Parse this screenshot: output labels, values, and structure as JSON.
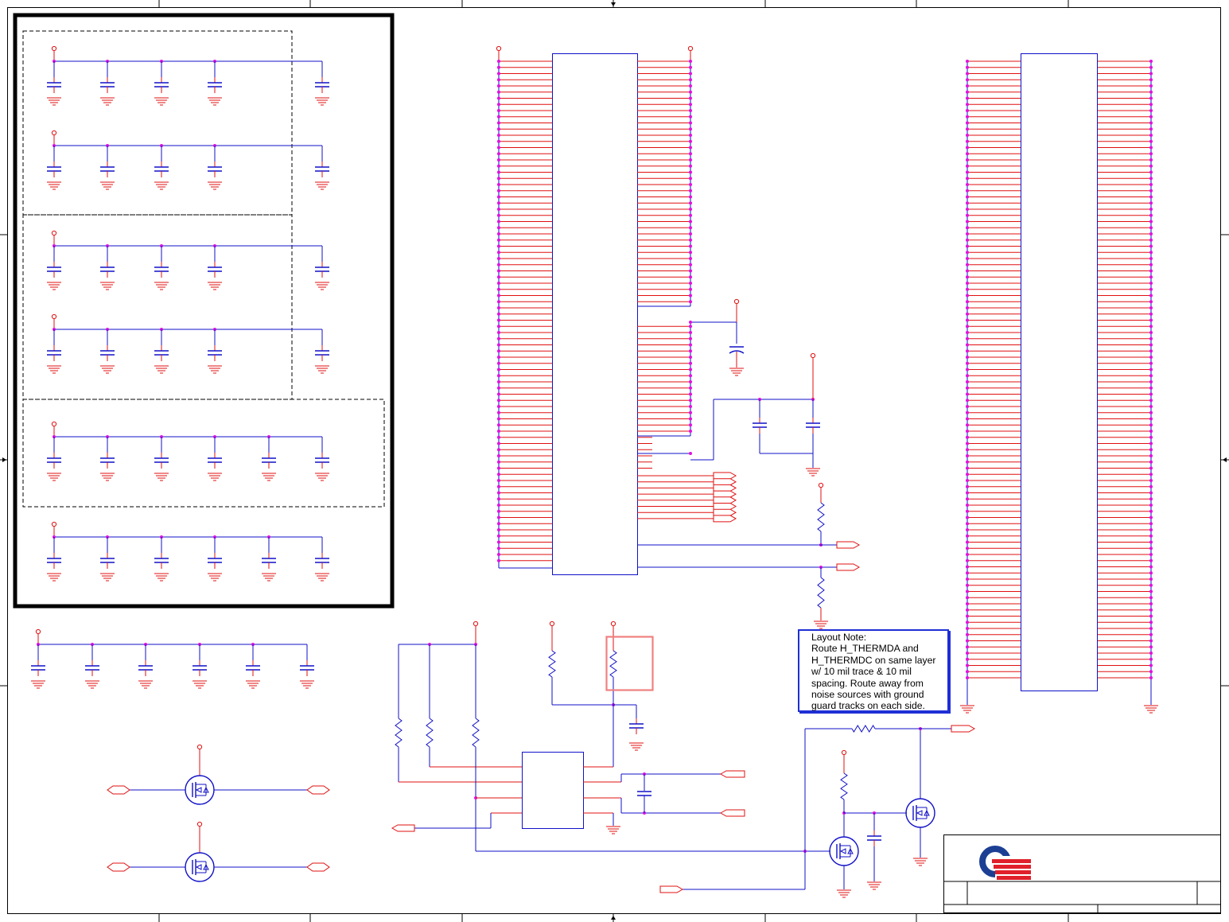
{
  "layout_note": {
    "title": "Layout Note:",
    "body": "Route H_THERMDA and\nH_THERMDC on same layer\nw/ 10 mil trace & 10 mil\nspacing. Route away from\nnoise sources with ground\nguard tracks on each side."
  },
  "colors": {
    "wire": "#1010c8",
    "pin": "#e01010",
    "junction": "#e010e0",
    "border": "#000000",
    "note_border": "#1f2fd6",
    "highlight": "#f08080",
    "logo_blue": "#1c3f94",
    "logo_red": "#e0202a"
  },
  "icons": {
    "power_port": "circle-on-stem",
    "ground": "ground-symbol",
    "capacitor": "capacitor-symbol",
    "resistor": "resistor-zigzag",
    "mosfet": "mosfet-circle-symbol",
    "offpage": "offpage-connector-flag",
    "logo": "company-logo"
  }
}
